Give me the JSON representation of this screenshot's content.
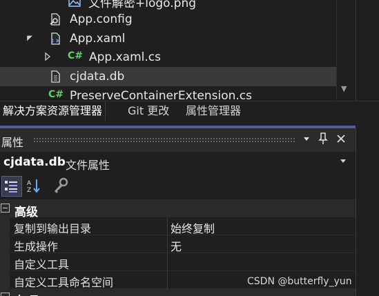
{
  "explorer": {
    "items": [
      {
        "label": "文件解密+logo.png",
        "icon": "image-file-icon"
      },
      {
        "label": "App.config",
        "icon": "config-file-icon"
      },
      {
        "label": "App.xaml",
        "icon": "xaml-file-icon",
        "expander": "▲"
      },
      {
        "label": "App.xaml.cs",
        "icon": "csharp-file-icon",
        "icon_text": "C#",
        "expander": "▷"
      },
      {
        "label": "cjdata.db",
        "icon": "db-file-icon",
        "selected": true
      },
      {
        "label": "PreserveContainerExtension.cs",
        "icon": "csharp-file-icon",
        "icon_text": "C#"
      }
    ],
    "scroll_down_glyph": "▼"
  },
  "tabs": [
    {
      "label": "解决方案资源管理器",
      "active": true
    },
    {
      "label": "Git 更改",
      "active": false
    },
    {
      "label": "属性管理器",
      "active": false
    }
  ],
  "properties": {
    "title": "属性",
    "title_buttons": {
      "dropdown": "▾",
      "pin": "📌",
      "close": "✕"
    },
    "object_name": "cjdata.db",
    "object_type": "文件属性",
    "object_dropdown": "▾",
    "toolbar": [
      {
        "name": "categorized-view-icon",
        "active": true
      },
      {
        "name": "alphabetical-sort-icon",
        "active": false
      },
      {
        "name": "property-pages-icon",
        "active": false
      }
    ],
    "category": {
      "label": "高级",
      "toggle": "−"
    },
    "rows": [
      {
        "name": "复制到输出目录",
        "value": "始终复制"
      },
      {
        "name": "生成操作",
        "value": "无"
      },
      {
        "name": "自定义工具",
        "value": ""
      },
      {
        "name": "自定义工具命名空间",
        "value": ""
      }
    ],
    "next_category": {
      "label": "杂项",
      "toggle": "−"
    }
  },
  "watermark": "CSDN @butterfly_yun",
  "colors": {
    "background": "#1f1f1f",
    "selection": "#3a3a3a",
    "accent": "#5a5a9e",
    "csharp_icon": "#5fd35f"
  }
}
